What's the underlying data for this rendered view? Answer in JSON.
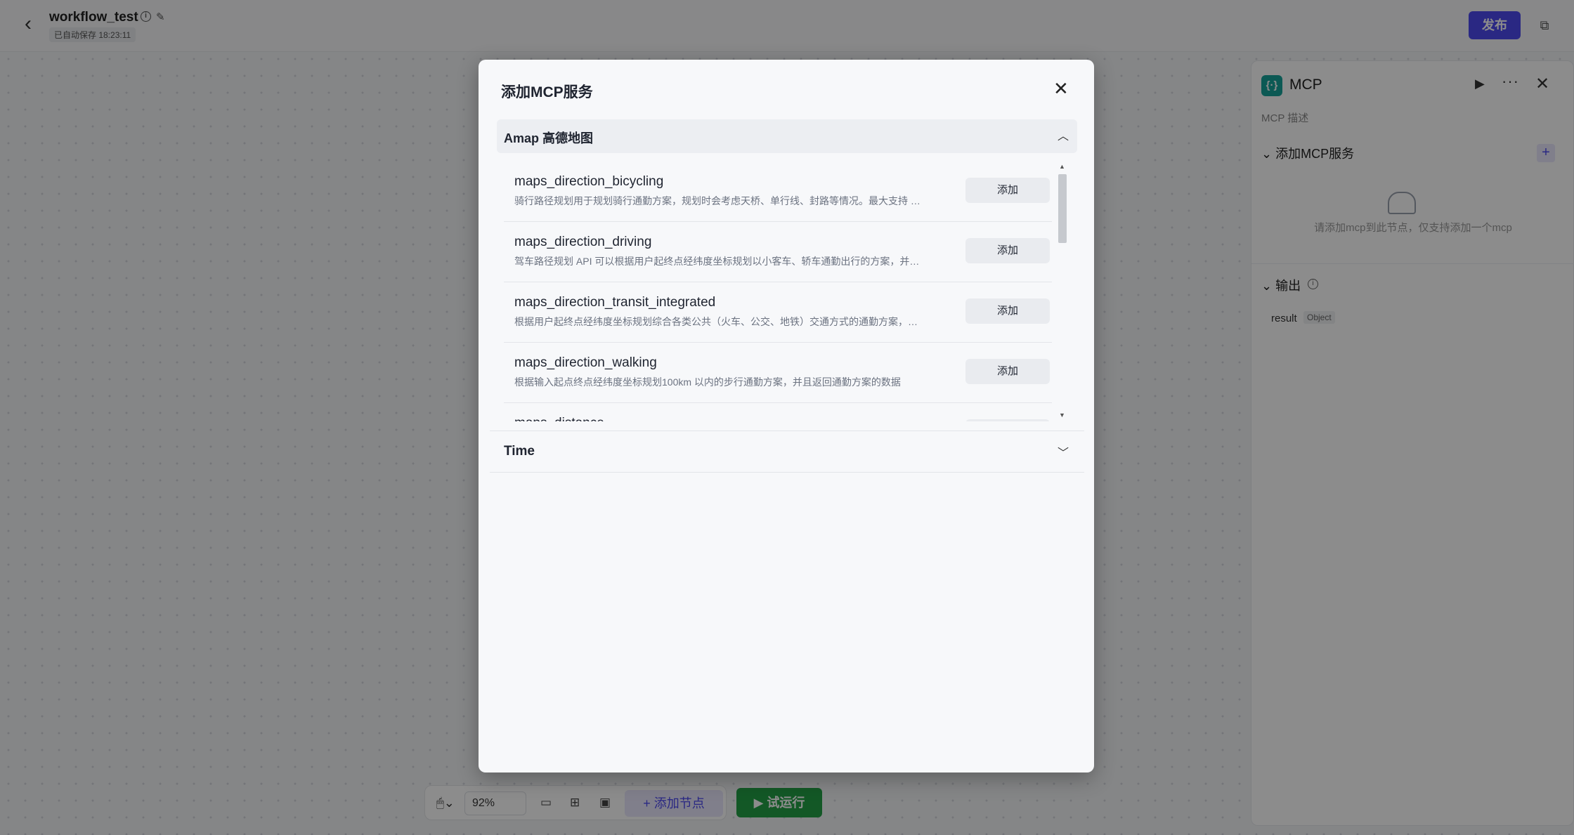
{
  "workflow": {
    "title": "workflow_test",
    "autosave": "已自动保存 18:23:11",
    "publish_label": "发布"
  },
  "node_panel": {
    "title": "MCP",
    "description": "MCP 描述",
    "add_section": "添加MCP服务",
    "empty_text": "请添加mcp到此节点，仅支持添加一个mcp",
    "output_section": "输出",
    "output_field": "result",
    "output_type": "Object"
  },
  "toolbar": {
    "zoom": "92%",
    "add_node_label": "添加节点",
    "run_label": "试运行"
  },
  "modal": {
    "title": "添加MCP服务",
    "groups": [
      {
        "name": "Amap 高德地图",
        "expanded": true,
        "tools": [
          {
            "name": "maps_direction_bicycling",
            "desc": "骑行路径规划用于规划骑行通勤方案，规划时会考虑天桥、单行线、封路等情况。最大支持 …",
            "add": "添加"
          },
          {
            "name": "maps_direction_driving",
            "desc": "驾车路径规划 API 可以根据用户起终点经纬度坐标规划以小客车、轿车通勤出行的方案，并…",
            "add": "添加"
          },
          {
            "name": "maps_direction_transit_integrated",
            "desc": "根据用户起终点经纬度坐标规划综合各类公共（火车、公交、地铁）交通方式的通勤方案，…",
            "add": "添加"
          },
          {
            "name": "maps_direction_walking",
            "desc": "根据输入起点终点经纬度坐标规划100km 以内的步行通勤方案，并且返回通勤方案的数据",
            "add": "添加"
          },
          {
            "name": "maps_distance",
            "desc": "",
            "add": "添加"
          }
        ]
      },
      {
        "name": "Time",
        "expanded": false
      }
    ]
  }
}
